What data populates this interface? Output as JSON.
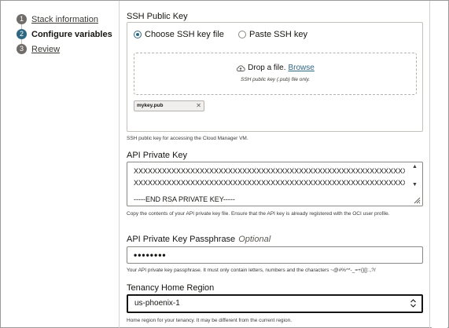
{
  "steps": [
    {
      "num": "1",
      "label": "Stack information"
    },
    {
      "num": "2",
      "label": "Configure variables"
    },
    {
      "num": "3",
      "label": "Review"
    }
  ],
  "ssh": {
    "label": "SSH Public Key",
    "option_file": "Choose SSH key file",
    "option_paste": "Paste SSH key",
    "selected": "Choose SSH key file",
    "drop_text": "Drop a file.",
    "browse_link": "Browse",
    "drop_hint": "SSH public key (.pub) file only.",
    "file_chip": "mykey.pub",
    "help": "SSH public key for accessing the Cloud Manager VM."
  },
  "api_key": {
    "label": "API Private Key",
    "line1": "XXXXXXXXXXXXXXXXXXXXXXXXXXXXXXXXXXXXXXXXXXXXXXXXXXXXXXXXXXXXXXXXXXXXXXXXXXXXXX",
    "line2": "XXXXXXXXXXXXXXXXXXXXXXXXXXXXXXXXXXXXXXXXXXXXXXXXXXXXXXXXXXXXXXXXXXXXXXXXXXXXXX",
    "line3_pre": "-----END ",
    "line3_err": "RSA",
    "line3_post": " PRIVATE KEY-----",
    "help": "Copy the contents of your API private key file. Ensure that the API key is already registered with the OCI user profile."
  },
  "passphrase": {
    "label": "API Private Key Passphrase",
    "optional": "Optional",
    "value": "••••••••",
    "help": "Your API private key passphrase. It must only contain letters, numbers and the characters ~@#%^*-_=+{}[]:.,?/"
  },
  "region": {
    "label": "Tenancy Home Region",
    "value": "us-phoenix-1",
    "help": "Home region for your tenancy. It may be different from the current region."
  },
  "colors": {
    "accent": "#2e6782",
    "step_inactive": "#6f6c69",
    "error": "#c74634"
  }
}
